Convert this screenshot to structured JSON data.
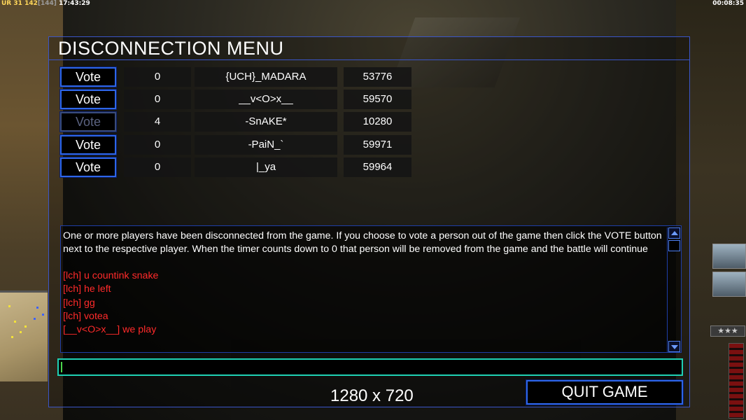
{
  "status_bar": {
    "tag": "UR",
    "value_a": "31",
    "value_b": "142",
    "value_c": "[144]",
    "clock": "17:43:29",
    "game_timer": "00:08:35"
  },
  "dialog": {
    "title": "DISCONNECTION MENU",
    "players": [
      {
        "vote_label": "Vote",
        "vote_enabled": true,
        "votes": "0",
        "name": "{UCH}_MADARA",
        "port": "53776"
      },
      {
        "vote_label": "Vote",
        "vote_enabled": true,
        "votes": "0",
        "name": "__v<O>x__",
        "port": "59570"
      },
      {
        "vote_label": "Vote",
        "vote_enabled": false,
        "votes": "4",
        "name": "-SnAKE*",
        "port": "10280"
      },
      {
        "vote_label": "Vote",
        "vote_enabled": true,
        "votes": "0",
        "name": "-PaiN_`",
        "port": "59971"
      },
      {
        "vote_label": "Vote",
        "vote_enabled": true,
        "votes": "0",
        "name": "|_ya",
        "port": "59964"
      }
    ],
    "system_message": "One or more players have been disconnected from the game. If you choose to vote a person out of the game then click the VOTE button next to the respective player. When the timer counts down to 0 that person will be removed from the game and the battle will continue",
    "chat_lines": [
      "[lch] u countink snake",
      "[lch] he left",
      "[lch] gg",
      "[lch] votea",
      "[__v<O>x__] we play"
    ],
    "chat_input_value": "",
    "resolution_label": "1280 x 720",
    "quit_label": "QUIT GAME"
  },
  "colors": {
    "accent_border": "#2e66e8",
    "chat_text": "#ff2a2a",
    "input_border": "#1fd1b4"
  },
  "hud": {
    "rank_label": "★★★"
  }
}
